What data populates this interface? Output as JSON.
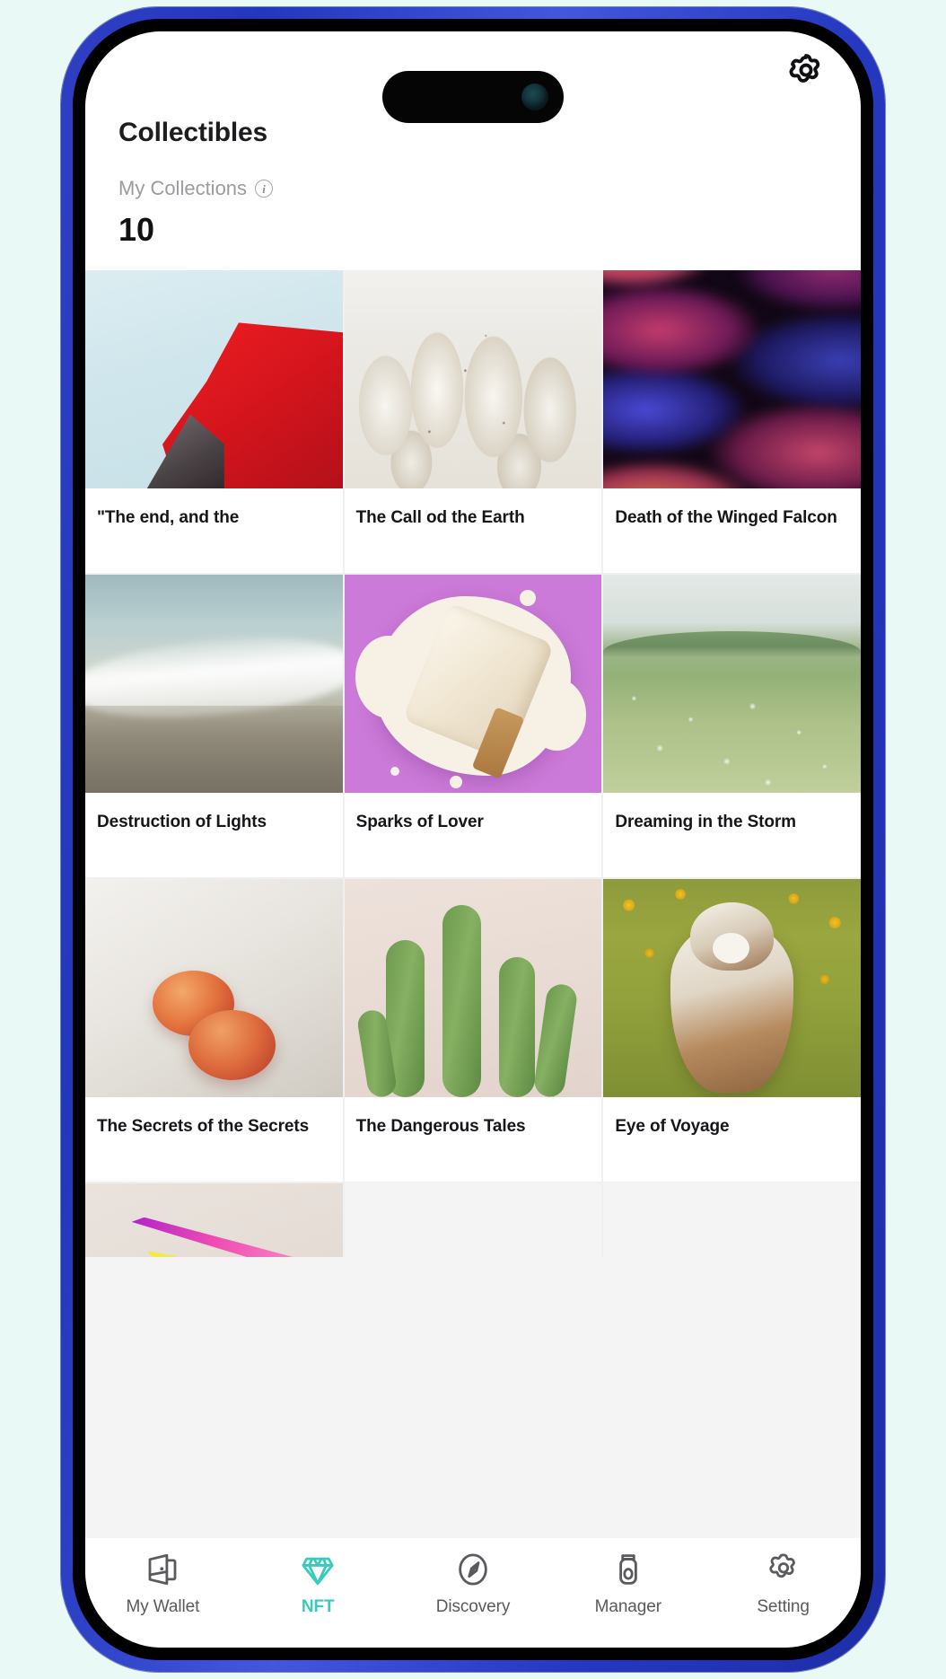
{
  "theme": {
    "page_background": "#e9faf6",
    "frame_color": "#2c3fc8",
    "accent_color": "#36cbbd",
    "title_color": "#1d1d1f",
    "muted_color": "#9b9b9f"
  },
  "device": {
    "dynamic_island": "dynamic-island",
    "camera_lens": "camera-lens",
    "buttons": {
      "silent_switch": "silent-switch",
      "volume_up": "volume-up-button",
      "volume_down": "volume-down-button",
      "power": "power-button"
    }
  },
  "header": {
    "settings_icon": "gear-icon",
    "title": "Collectibles",
    "collections_label": "My Collections",
    "info_icon": "info-icon",
    "collections_count": "10"
  },
  "grid": {
    "items": [
      {
        "title": "\"The end, and the",
        "art": "art-flag",
        "name": "nft-card-the-end-and-the"
      },
      {
        "title": "The Call od the Earth",
        "art": "art-coral",
        "name": "nft-card-the-call-od-the-earth"
      },
      {
        "title": "Death of the Winged Falcon",
        "art": "art-waves",
        "name": "nft-card-death-of-the-winged-falcon"
      },
      {
        "title": "Destruction of Lights",
        "art": "art-wave",
        "name": "nft-card-destruction-of-lights"
      },
      {
        "title": "Sparks of Lover",
        "art": "art-popsicle",
        "name": "nft-card-sparks-of-lover"
      },
      {
        "title": "Dreaming in the Storm",
        "art": "art-meadow",
        "name": "nft-card-dreaming-in-the-storm"
      },
      {
        "title": "The Secrets of the Secrets",
        "art": "art-peach",
        "name": "nft-card-the-secrets-of-the-secrets"
      },
      {
        "title": "The Dangerous Tales",
        "art": "art-cactus",
        "name": "nft-card-the-dangerous-tales"
      },
      {
        "title": "Eye of Voyage",
        "art": "art-husky",
        "name": "nft-card-eye-of-voyage"
      },
      {
        "title": "",
        "art": "art-geo",
        "name": "nft-card-partial",
        "partial": true
      }
    ]
  },
  "tab_bar": {
    "items": [
      {
        "label": "My Wallet",
        "icon": "wallet-icon",
        "active": false
      },
      {
        "label": "NFT",
        "icon": "diamond-icon",
        "active": true
      },
      {
        "label": "Discovery",
        "icon": "compass-icon",
        "active": false
      },
      {
        "label": "Manager",
        "icon": "usb-key-icon",
        "active": false
      },
      {
        "label": "Setting",
        "icon": "gear-icon",
        "active": false
      }
    ]
  }
}
